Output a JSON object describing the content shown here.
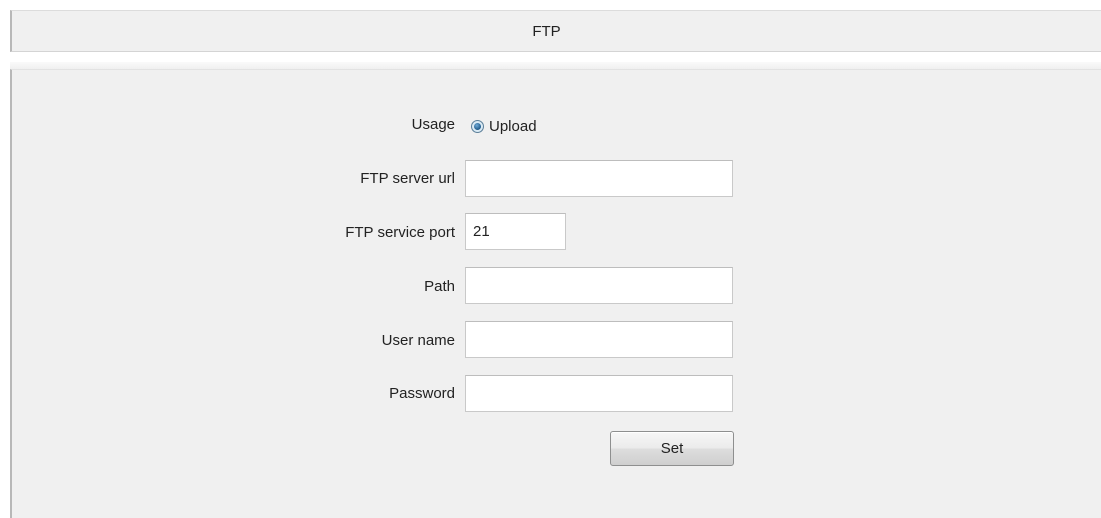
{
  "header": {
    "title": "FTP"
  },
  "form": {
    "usage": {
      "label": "Usage",
      "option_label": "Upload",
      "selected": true
    },
    "server_url": {
      "label": "FTP server url",
      "value": ""
    },
    "service_port": {
      "label": "FTP service port",
      "value": "21"
    },
    "path": {
      "label": "Path",
      "value": ""
    },
    "user_name": {
      "label": "User name",
      "value": ""
    },
    "password": {
      "label": "Password",
      "value": ""
    },
    "set_button_label": "Set"
  },
  "colors": {
    "panel_background": "#f0f0f0",
    "input_border": "#c9c9c9",
    "radio_accent": "#1f5a8a"
  }
}
